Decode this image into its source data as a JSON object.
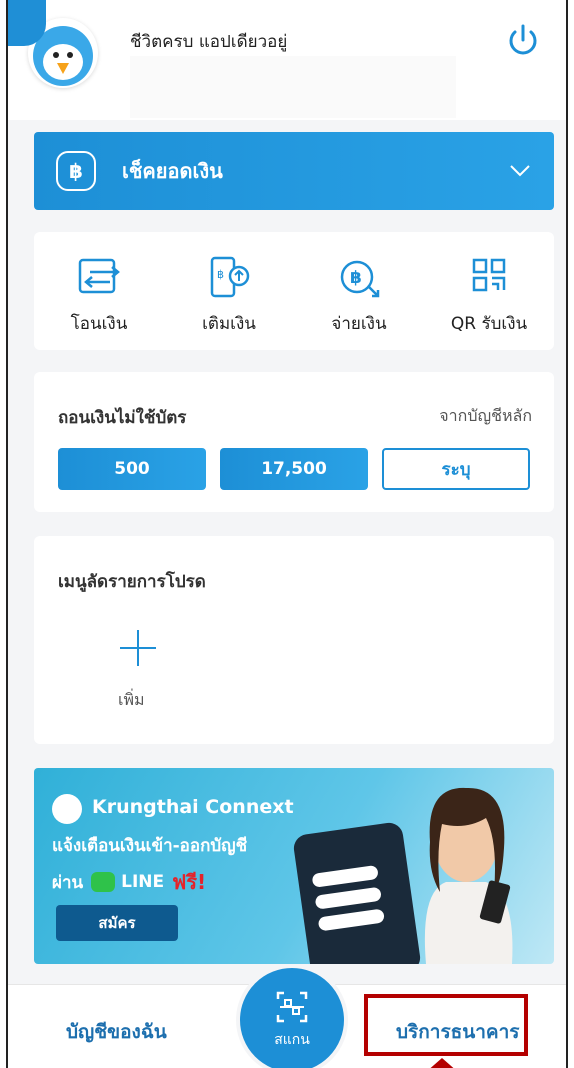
{
  "header": {
    "greeting": "ชีวิตครบ แอปเดียวอยู่"
  },
  "balance": {
    "label": "เช็คยอดเงิน",
    "currency_symbol": "฿"
  },
  "actions": [
    {
      "label": "โอนเงิน",
      "icon": "transfer-icon"
    },
    {
      "label": "เติมเงิน",
      "icon": "topup-icon"
    },
    {
      "label": "จ่ายเงิน",
      "icon": "pay-icon"
    },
    {
      "label": "QR รับเงิน",
      "icon": "qr-icon"
    }
  ],
  "withdraw": {
    "title": "ถอนเงินไม่ใช้บัตร",
    "source": "จากบัญชีหลัก",
    "amounts": [
      "500",
      "17,500"
    ],
    "custom_label": "ระบุ"
  },
  "favorites": {
    "title": "เมนูลัดรายการโปรด",
    "add_label": "เพิ่ม"
  },
  "banner": {
    "brand": "Krungthai Connext",
    "line1": "แจ้งเตือนเงินเข้า-ออกบัญชี",
    "via": "ผ่าน",
    "line_word": "LINE",
    "free_word": "ฟรี!",
    "signup_label": "สมัคร"
  },
  "bottom_nav": {
    "left_label": "บัญชีของฉัน",
    "scan_label": "สแกน",
    "right_label": "บริการธนาคาร"
  },
  "colors": {
    "primary": "#1d8fd6",
    "highlight": "#b40000"
  }
}
